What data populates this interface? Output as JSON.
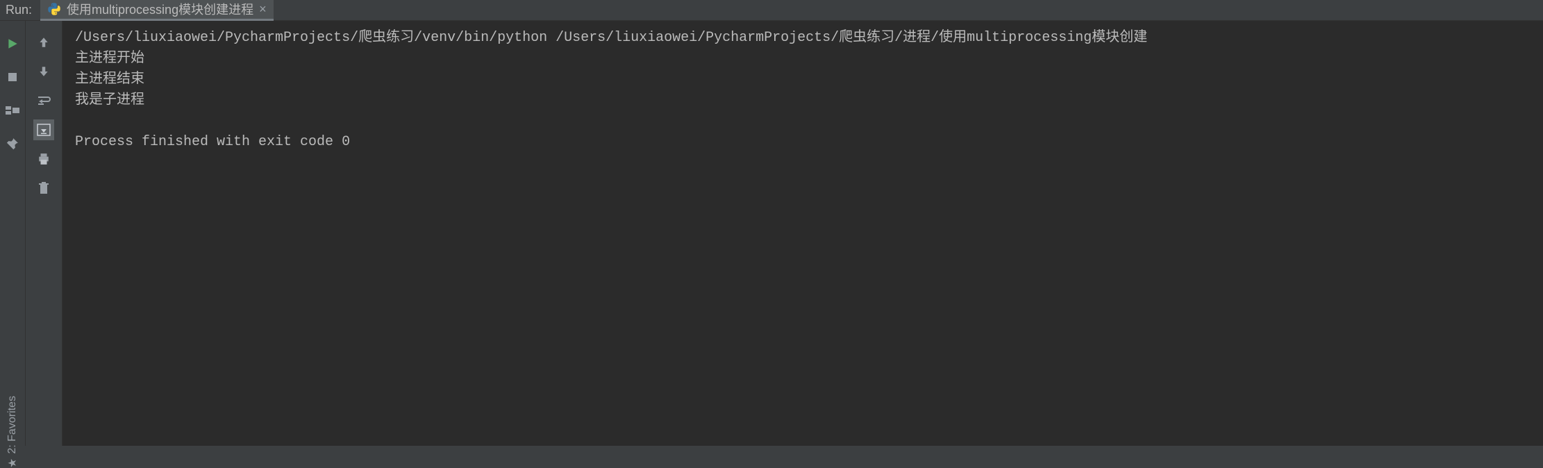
{
  "header": {
    "panel_title": "Run:",
    "tab_label": "使用multiprocessing模块创建进程"
  },
  "console": {
    "lines": [
      "/Users/liuxiaowei/PycharmProjects/爬虫练习/venv/bin/python /Users/liuxiaowei/PycharmProjects/爬虫练习/进程/使用multiprocessing模块创建",
      "主进程开始",
      "主进程结束",
      "我是子进程",
      "",
      "Process finished with exit code 0"
    ]
  },
  "favorites": {
    "label": "2: Favorites"
  },
  "icons": {
    "run": "run-icon",
    "stop": "stop-icon",
    "layout": "layout-icon",
    "pin": "pin-icon",
    "up": "arrow-up-icon",
    "down": "arrow-down-icon",
    "soft_wrap": "soft-wrap-icon",
    "scroll_end": "scroll-to-end-icon",
    "print": "print-icon",
    "clear": "clear-icon"
  }
}
